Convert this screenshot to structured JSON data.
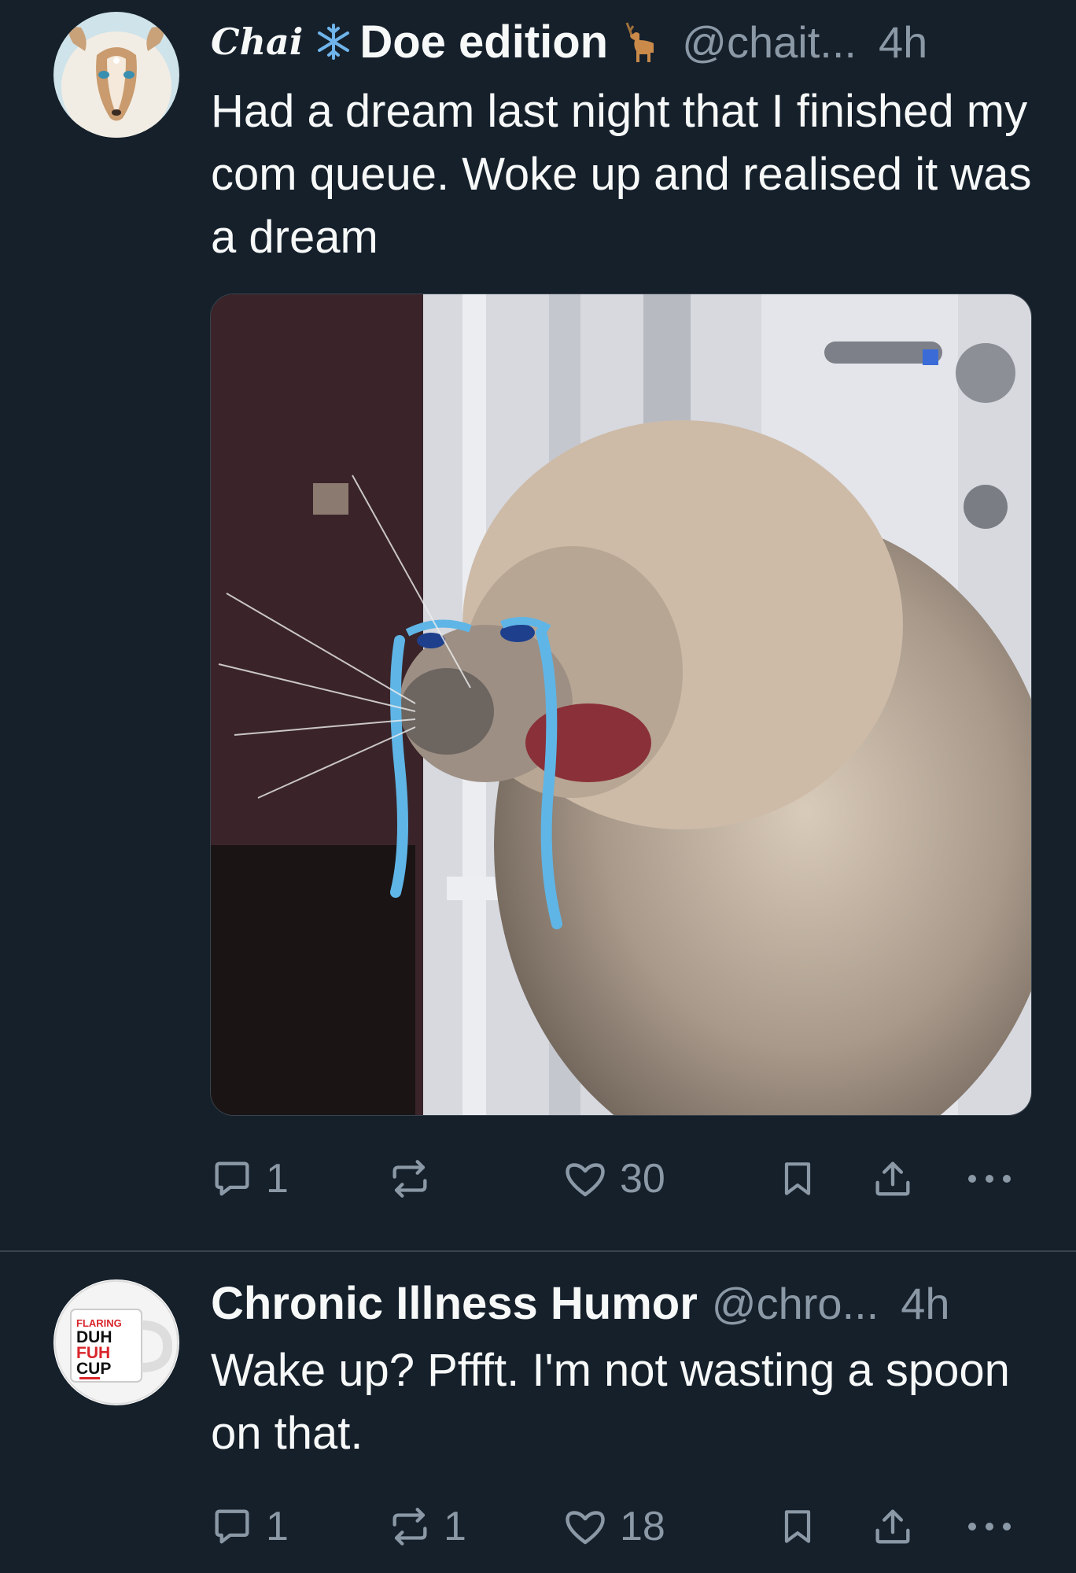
{
  "tweets": [
    {
      "author": {
        "name_script": "Chai",
        "name_emoji": "snowflake-icon",
        "name": "Doe edition",
        "name_emoji_2": "deer-icon",
        "handle": "@chait...",
        "avatar": "deer-character-avatar"
      },
      "time": "4h",
      "text": "Had a dream last night that I finished my com queue. Woke up and realised it was a dream",
      "media": "crying-cat-meme-image",
      "actions": {
        "reply_count": "1",
        "repost_count": "",
        "like_count": "30"
      }
    },
    {
      "author": {
        "name": "Chronic Illness Humor",
        "handle": "@chro...",
        "avatar": "mug-avatar",
        "avatar_text": [
          "FLARING",
          "DUH",
          "FUH",
          "CUP"
        ]
      },
      "time": "4h",
      "text": "Wake up? Pffft. I'm not wasting a spoon on that.",
      "actions": {
        "reply_count": "1",
        "repost_count": "1",
        "like_count": "18"
      }
    }
  ],
  "colors": {
    "background": "#15202b",
    "text": "#f7f9f9",
    "muted": "#8b98a5",
    "divider": "#38444d"
  }
}
